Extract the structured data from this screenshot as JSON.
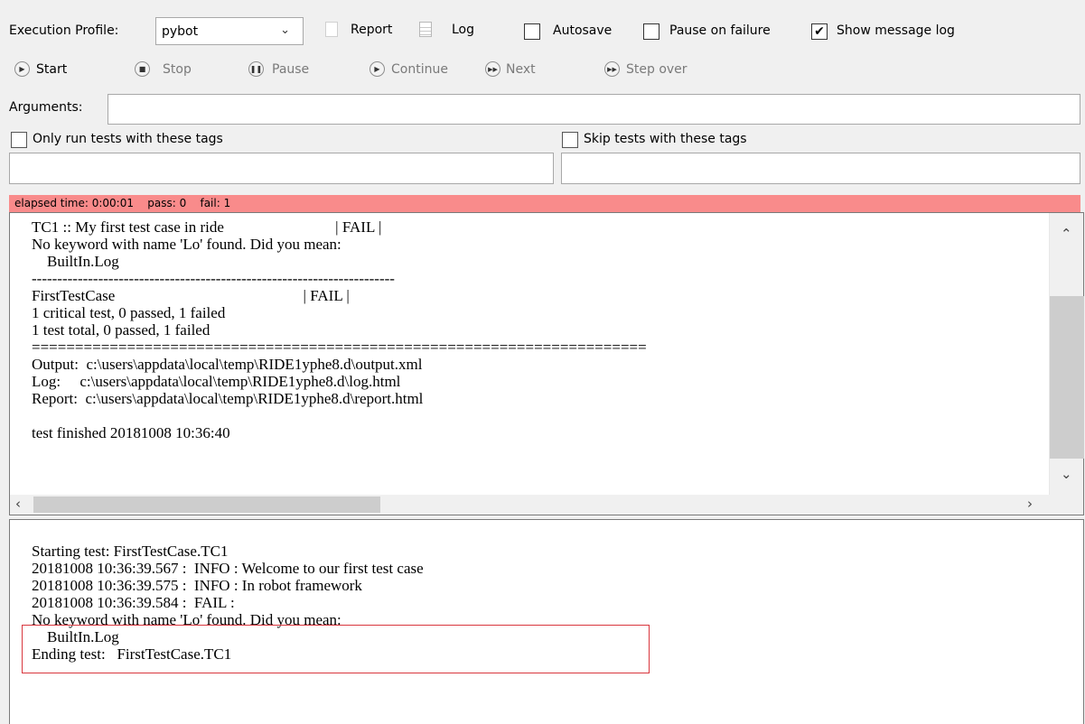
{
  "toolbar": {
    "execution_profile_label": "Execution Profile:",
    "execution_profile_value": "pybot",
    "report_label": "Report",
    "log_label": "Log",
    "autosave_label": "Autosave",
    "autosave_checked": false,
    "pause_on_failure_label": "Pause on failure",
    "pause_on_failure_checked": false,
    "show_message_log_label": "Show message log",
    "show_message_log_checked": true
  },
  "controls": {
    "start": "Start",
    "stop": "Stop",
    "pause": "Pause",
    "continue": "Continue",
    "next": "Next",
    "step_over": "Step over"
  },
  "arguments": {
    "label": "Arguments:",
    "value": ""
  },
  "tags": {
    "only_run_label": "Only run tests with these tags",
    "only_run_value": "",
    "skip_label": "Skip tests with these tags",
    "skip_value": ""
  },
  "status": {
    "text": "elapsed time: 0:00:01    pass: 0    fail: 1",
    "color": "#f98b8b"
  },
  "output_text": "TC1 :: My first test case in ride                             | FAIL |\nNo keyword with name 'Lo' found. Did you mean:\n    BuiltIn.Log\n-----------------------------------------------------------------------\nFirstTestCase                                                 | FAIL |\n1 critical test, 0 passed, 1 failed\n1 test total, 0 passed, 1 failed\n=======================================================================\nOutput:  c:\\users\\appdata\\local\\temp\\RIDE1yphe8.d\\output.xml\nLog:     c:\\users\\appdata\\local\\temp\\RIDE1yphe8.d\\log.html\nReport:  c:\\users\\appdata\\local\\temp\\RIDE1yphe8.d\\report.html\n\ntest finished 20181008 10:36:40",
  "message_log_text": "Starting test: FirstTestCase.TC1\n20181008 10:36:39.567 :  INFO : Welcome to our first test case\n20181008 10:36:39.575 :  INFO : In robot framework\n20181008 10:36:39.584 :  FAIL :\nNo keyword with name 'Lo' found. Did you mean:\n    BuiltIn.Log\nEnding test:   FirstTestCase.TC1"
}
